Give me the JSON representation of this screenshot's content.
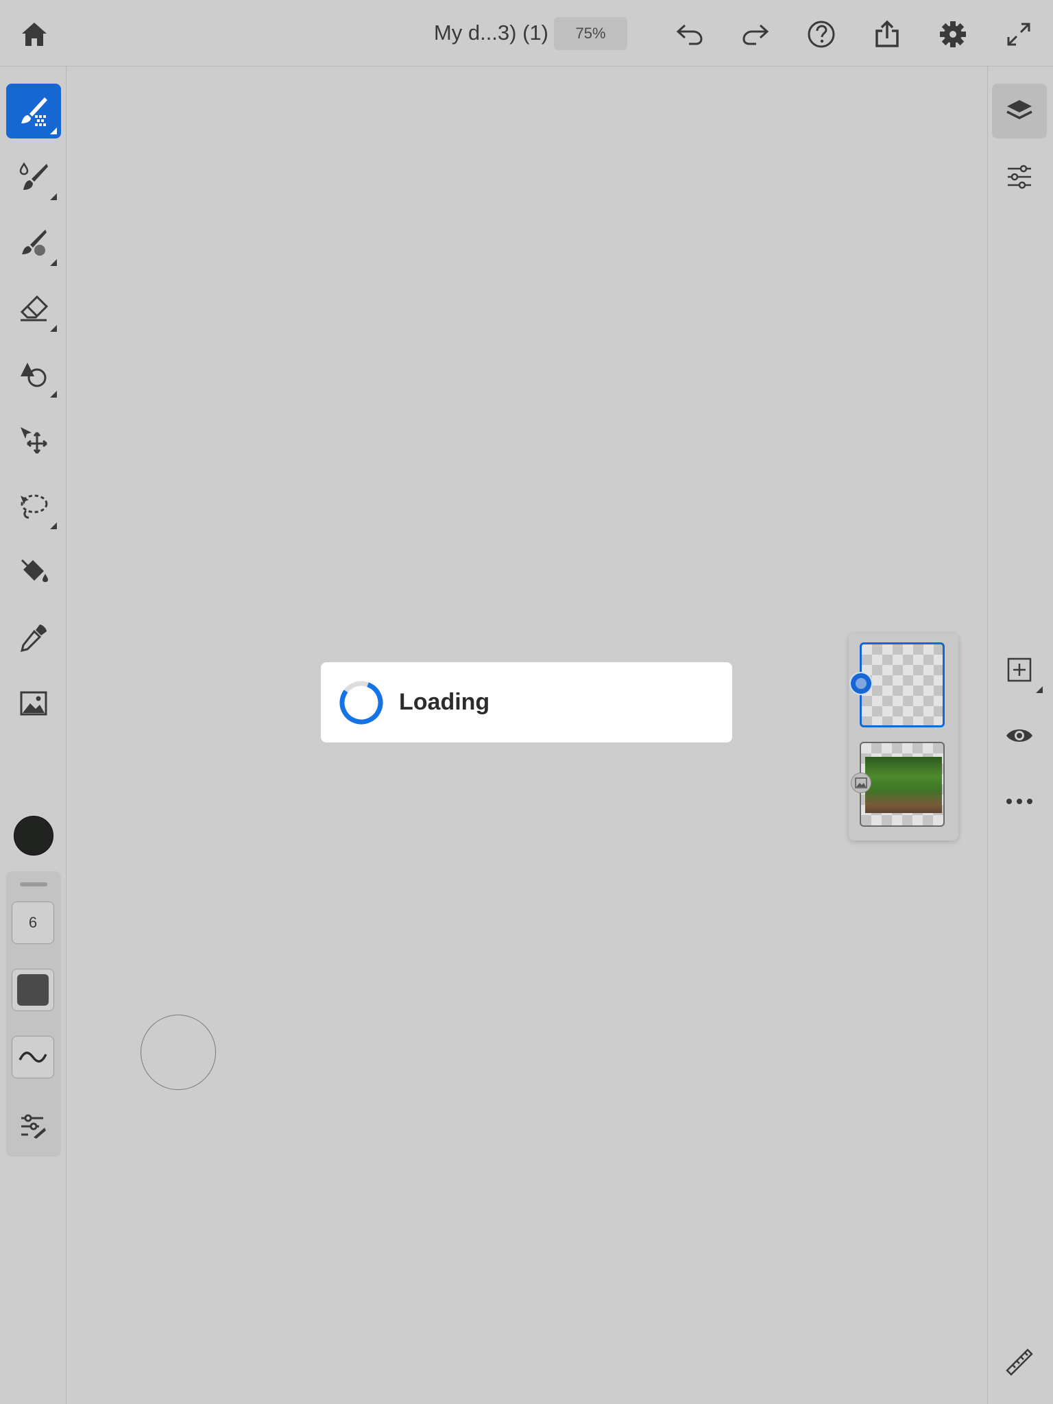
{
  "header": {
    "document_title": "My d...3) (1)",
    "zoom_level": "75%",
    "icons": [
      "home-icon",
      "undo-icon",
      "redo-icon",
      "help-icon",
      "share-icon",
      "settings-icon",
      "fullscreen-icon"
    ]
  },
  "left_toolbar": {
    "tools": [
      "pixel-brush",
      "live-brush",
      "mixer-brush",
      "eraser",
      "shape",
      "transform",
      "lasso",
      "fill",
      "eyedropper",
      "image"
    ],
    "active_tool": "pixel-brush",
    "color": "#202320",
    "brush_size": "6",
    "tool_options_icons": [
      "opacity-swatch",
      "smoothing-icon",
      "brush-settings-icon"
    ]
  },
  "right_toolbar": {
    "icons": [
      "layers-icon",
      "properties-icon",
      "add-layer-icon",
      "visibility-icon",
      "more-icon",
      "ruler-icon"
    ],
    "active": "layers-icon"
  },
  "layers_panel": {
    "layers": [
      {
        "type": "pixel",
        "selected": true
      },
      {
        "type": "image",
        "selected": false
      }
    ]
  },
  "dialog": {
    "text": "Loading"
  },
  "colors": {
    "accent": "#1666d4",
    "background": "#cdcdcd"
  }
}
